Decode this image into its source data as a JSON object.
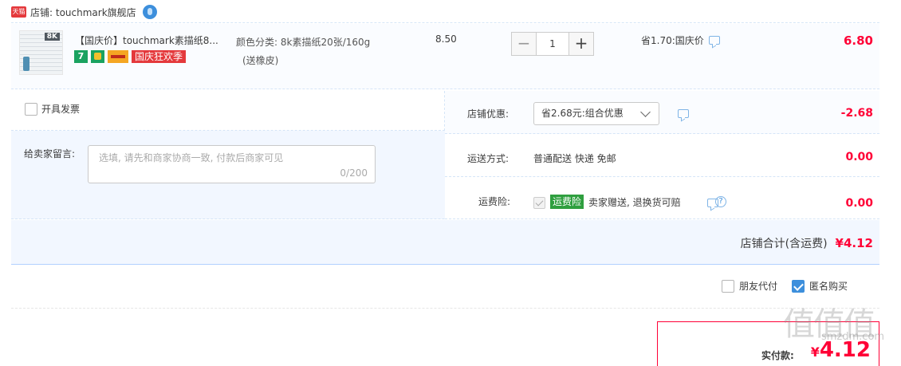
{
  "shop": {
    "logo_text": "天猫",
    "name": "店铺: touchmark旗舰店",
    "wangwang_icon": "wangwang-chat-icon"
  },
  "item": {
    "title": "【国庆价】touchmark素描纸8...",
    "thumb_label": "8K",
    "badge_seven": "7",
    "promo_tag": "国庆狂欢季",
    "sku_line1": "颜色分类: 8k素描纸20张/160g",
    "sku_line2": "(送橡皮)",
    "unit_price": "8.50",
    "qty_minus": "−",
    "qty_value": "1",
    "qty_plus": "+",
    "discount_note": "省1.70:国庆价",
    "total": "6.80"
  },
  "options": {
    "invoice_label": "开具发票",
    "message_label": "给卖家留言:",
    "message_placeholder": "选填, 请先和商家协商一致, 付款后商家可见",
    "message_count": "0/200",
    "coupon_label": "店铺优惠:",
    "coupon_value": "省2.68元:组合优惠",
    "coupon_amount": "-2.68",
    "shipping_label": "运送方式:",
    "shipping_value": "普通配送 快递 免邮",
    "shipping_amount": "0.00",
    "insurance_label": "运费险:",
    "insurance_tag": "运费险",
    "insurance_text": "卖家赠送, 退换货可赔",
    "insurance_amount": "0.00"
  },
  "summary": {
    "shop_total_label": "店铺合计(含运费)",
    "shop_total_value": "¥4.12"
  },
  "bottom": {
    "friend_pay_label": "朋友代付",
    "anonymous_label": "匿名购买",
    "anonymous_checked": true,
    "pay_label": "实付款:",
    "pay_currency": "¥",
    "pay_value": "4.12"
  },
  "watermark": {
    "text": "值值值",
    "url": "smzdm.com"
  },
  "colors": {
    "price_red": "#ff0036",
    "brand_blue": "#3d8fdc",
    "panel_bg": "#f2f7ff"
  }
}
